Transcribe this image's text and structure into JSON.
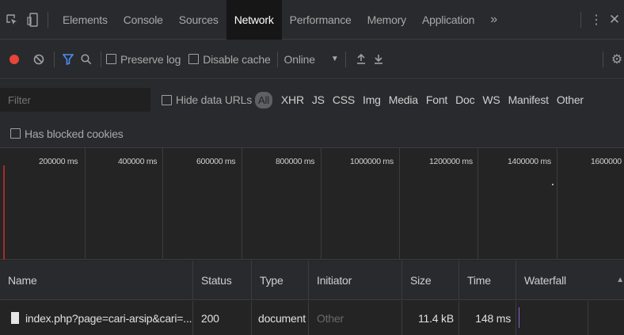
{
  "tabs": [
    "Elements",
    "Console",
    "Sources",
    "Network",
    "Performance",
    "Memory",
    "Application"
  ],
  "active_tab": "Network",
  "more_tabs": "»",
  "toolbar": {
    "preserve_log": "Preserve log",
    "disable_cache": "Disable cache",
    "throttling": "Online",
    "throttling_arrow": "▼"
  },
  "filter": {
    "placeholder": "Filter",
    "hide_data_urls": "Hide data URLs",
    "types": [
      "All",
      "XHR",
      "JS",
      "CSS",
      "Img",
      "Media",
      "Font",
      "Doc",
      "WS",
      "Manifest",
      "Other"
    ],
    "active_type": "All",
    "has_blocked_cookies": "Has blocked cookies"
  },
  "overview": {
    "ticks": [
      "200000 ms",
      "400000 ms",
      "600000 ms",
      "800000 ms",
      "1000000 ms",
      "1200000 ms",
      "1400000 ms",
      "1600000"
    ]
  },
  "table": {
    "columns": [
      "Name",
      "Status",
      "Type",
      "Initiator",
      "Size",
      "Time",
      "Waterfall"
    ],
    "sort_indicator": "▲",
    "rows": [
      {
        "name": "index.php?page=cari-arsip&cari=...",
        "status": "200",
        "type": "document",
        "initiator": "Other",
        "size": "11.4 kB",
        "time": "148 ms"
      }
    ]
  },
  "colors": {
    "record": "#e8443a",
    "filter_active": "#4c8df6",
    "panel_bg": "#292a2d",
    "active_tab_bg": "#161616"
  }
}
